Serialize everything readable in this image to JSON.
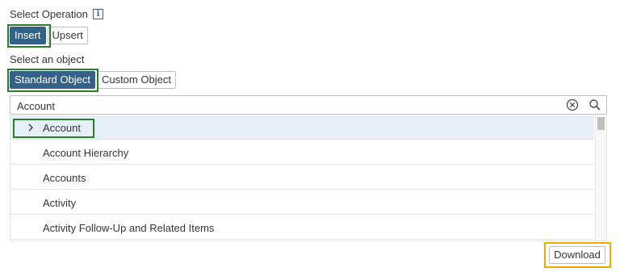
{
  "operation": {
    "label": "Select Operation",
    "info_icon": "i",
    "buttons": [
      {
        "label": "Insert",
        "active": true
      },
      {
        "label": "Upsert",
        "active": false
      }
    ]
  },
  "object": {
    "label": "Select an object",
    "buttons": [
      {
        "label": "Standard Object",
        "active": true
      },
      {
        "label": "Custom Object",
        "active": false
      }
    ]
  },
  "search": {
    "value": "Account",
    "clear_icon": "clear-circle-icon",
    "search_icon": "search-icon"
  },
  "list": {
    "items": [
      {
        "label": "Account",
        "selected": true,
        "expandable": true
      },
      {
        "label": "Account Hierarchy",
        "selected": false
      },
      {
        "label": "Accounts",
        "selected": false
      },
      {
        "label": "Activity",
        "selected": false
      },
      {
        "label": "Activity Follow-Up and Related Items",
        "selected": false
      }
    ]
  },
  "footer": {
    "download_label": "Download"
  },
  "colors": {
    "active_button": "#346187",
    "selected_row": "#e5f0fa",
    "highlight_green": "#2b7c2b",
    "highlight_orange": "#f0ab00",
    "link_blue": "#0a6ed1"
  }
}
